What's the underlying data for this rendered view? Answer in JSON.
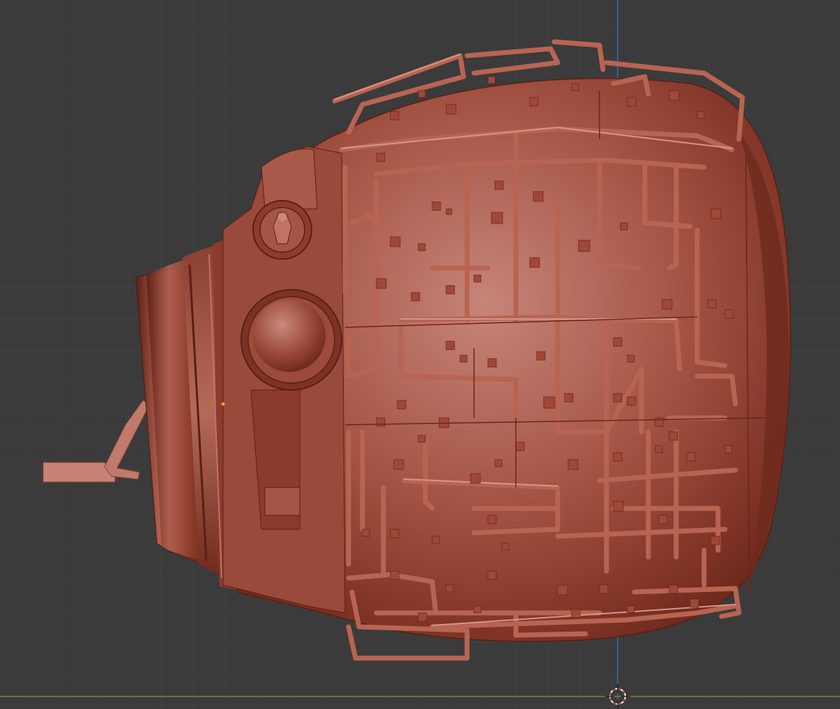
{
  "viewport": {
    "background_color": "#3b3b3b",
    "grid_minor_color": "#444444",
    "grid_major_color": "#4a4a4a",
    "axis_x_color": "#6a8a3a",
    "axis_z_color": "#2f6fbf",
    "model_color": "#a44a3a",
    "model_highlight_color": "#c98374",
    "cursor_color_a": "#d04040",
    "cursor_color_b": "#ffffff"
  },
  "icons": {
    "cursor": "3d-cursor-icon",
    "origin": "object-origin-icon"
  }
}
